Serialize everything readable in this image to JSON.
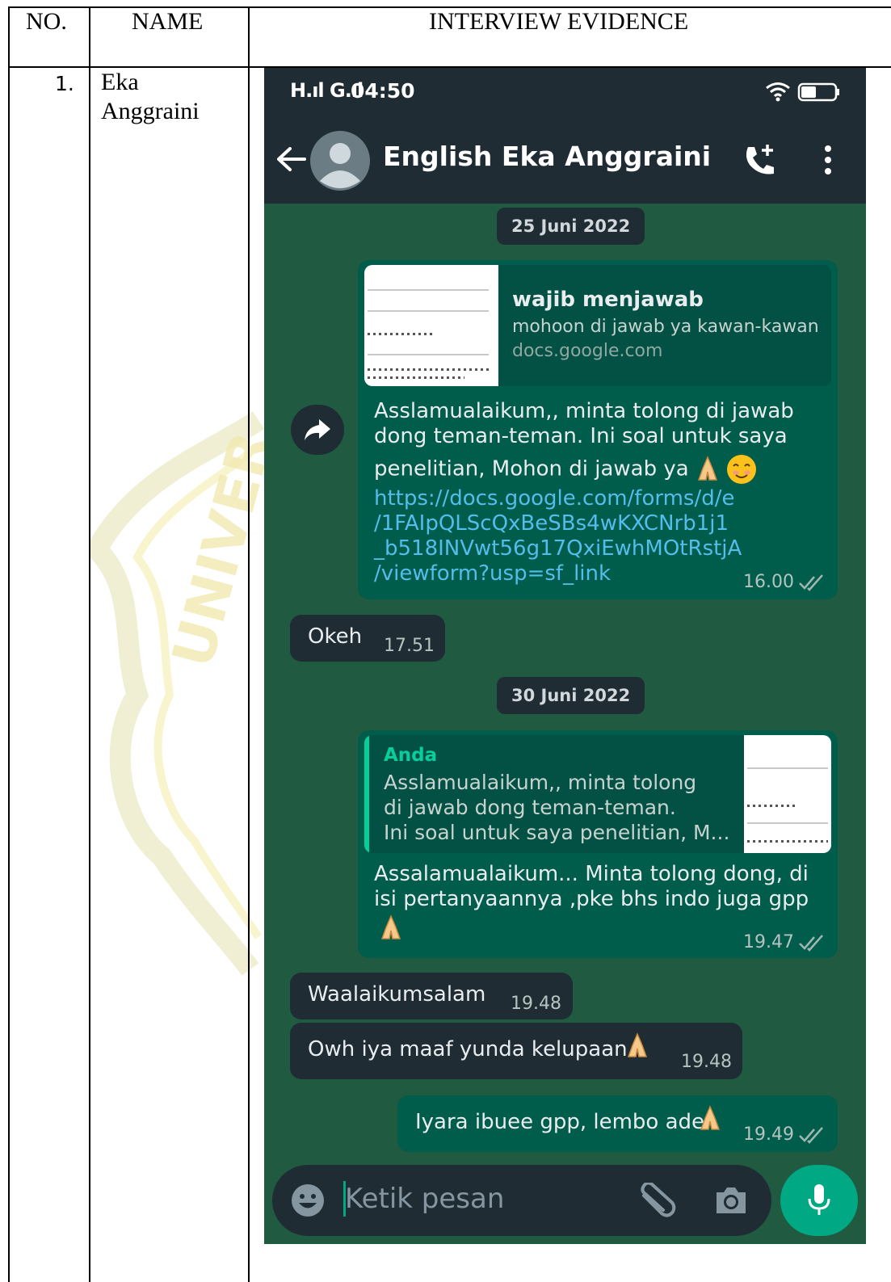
{
  "table": {
    "headers": [
      "NO.",
      "NAME",
      "INTERVIEW EVIDENCE"
    ],
    "row": {
      "no": "1.",
      "name_line1": "Eka",
      "name_line2": "Anggraini"
    }
  },
  "phone": {
    "status": {
      "network": "H.ıl G.ıl",
      "time": "04:50"
    },
    "chat_title": "English Eka Anggraini",
    "colors": {
      "chat_bg": "#1f5a41",
      "outgoing": "#005c4b",
      "incoming": "#1f2c33",
      "link": "#53bdeb",
      "accent": "#00a884"
    },
    "messages": {
      "date1": "25 Juni 2022",
      "preview_title": "wajib menjawab",
      "preview_desc": "mohoon di jawab ya kawan-kawan",
      "preview_domain": "docs.google.com",
      "msg1_line1": "Asslamualaikum,,  minta tolong di jawab",
      "msg1_line2": "dong teman-teman. Ini soal untuk saya",
      "msg1_line3": "penelitian, Mohon di jawab ya",
      "msg1_link1": "https://docs.google.com/forms/d/e",
      "msg1_link2": "/1FAIpQLScQxBeSBs4wKXCNrb1j1",
      "msg1_link3": "_b518INVwt56g17QxiEwhMOtRstjA",
      "msg1_link4": "/viewform?usp=sf_link",
      "msg1_time": "16.00",
      "reply1_text": "Okeh",
      "reply1_time": "17.51",
      "date2": "30 Juni 2022",
      "quote_author": "Anda",
      "quote_line1": "Asslamualaikum,,  minta tolong",
      "quote_line2": "di jawab dong teman-teman.",
      "quote_line3": "Ini soal untuk saya penelitian, M...",
      "msg2_line1": "Assalamualaikum... Minta tolong dong, di",
      "msg2_line2": "isi  pertanyaannya ,pke bhs indo juga gpp",
      "msg2_time": "19.47",
      "reply2_text": "Waalaikumsalam",
      "reply2_time": "19.48",
      "reply3_text": "Owh iya maaf yunda kelupaan",
      "reply3_time": "19.48",
      "msg3_text": "Iyara ibuee gpp, lembo ade",
      "msg3_time": "19.49"
    },
    "input_placeholder": "Ketik pesan"
  }
}
